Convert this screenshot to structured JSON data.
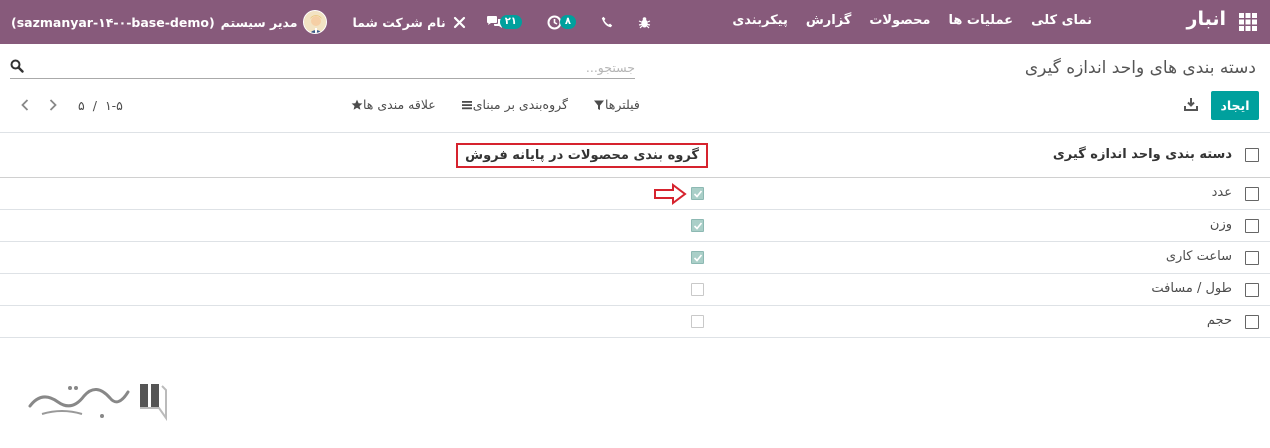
{
  "nav": {
    "brand": "انبار",
    "menu": [
      {
        "label": "نمای کلی"
      },
      {
        "label": "عملیات ها"
      },
      {
        "label": "محصولات"
      },
      {
        "label": "گزارش"
      },
      {
        "label": "پیکربندی"
      }
    ],
    "activity_count": "۸",
    "messages_count": "۲۱",
    "company": "نام شرکت شما",
    "user": "مدیر سیستم",
    "database": "(sazmanyar-۱۴-۰-base-demo)"
  },
  "control_panel": {
    "title": "دسته بندی های واحد اندازه گیری",
    "search_placeholder": "جستجو...",
    "create_label": "ایجاد",
    "filters_label": "فیلترها",
    "groupby_label": "گروه‌بندی بر مبنای",
    "favorites_label": "علاقه مندی ها",
    "pager_value": "۱-۵",
    "pager_separator": "/",
    "pager_limit": "۵"
  },
  "table": {
    "columns": {
      "name": "دسته بندی واحد اندازه گیری",
      "pos_group": "گروه بندی محصولات در پایانه فروش"
    },
    "rows": [
      {
        "name": "عدد",
        "pos_group": true
      },
      {
        "name": "وزن",
        "pos_group": true
      },
      {
        "name": "ساعت کاری",
        "pos_group": true
      },
      {
        "name": "طول / مسافت",
        "pos_group": false
      },
      {
        "name": "حجم",
        "pos_group": false
      }
    ]
  },
  "colors": {
    "navbar": "#875a7b",
    "primary": "#00a09d",
    "highlight": "#d6232e"
  }
}
